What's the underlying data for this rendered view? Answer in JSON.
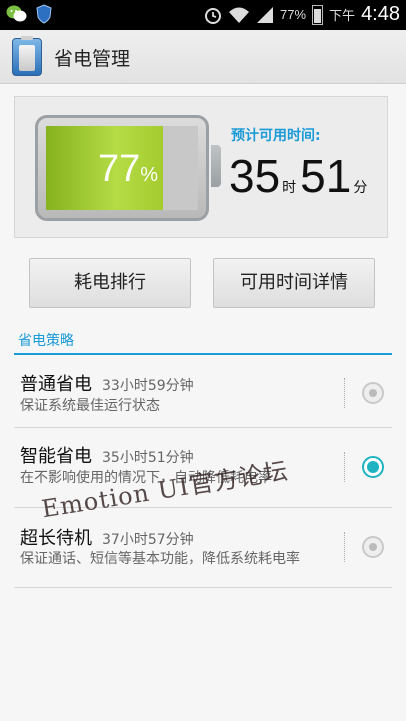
{
  "status_bar": {
    "icons": [
      "wechat-icon",
      "shield-icon",
      "alarm-icon",
      "wifi-icon",
      "signal-icon",
      "battery-icon"
    ],
    "battery_percent": "77%",
    "period": "下午",
    "time": "4:48"
  },
  "action_bar": {
    "title": "省电管理"
  },
  "battery": {
    "level": 0.77,
    "percent_value": "77",
    "percent_sign": "%",
    "fill_color": "#a4cc2f",
    "remain_label": "预计可用时间:",
    "hours": "35",
    "hours_unit": "时",
    "minutes": "51",
    "minutes_unit": "分"
  },
  "buttons": {
    "rank_label": "耗电排行",
    "detail_label": "可用时间详情"
  },
  "section": {
    "title": "省电策略"
  },
  "strategies": [
    {
      "title": "普通省电",
      "time": "33小时59分钟",
      "desc": "保证系统最佳运行状态",
      "selected": false
    },
    {
      "title": "智能省电",
      "time": "35小时51分钟",
      "desc": "在不影响使用的情况下，自动降低耗电率",
      "selected": true
    },
    {
      "title": "超长待机",
      "time": "37小时57分钟",
      "desc": "保证通话、短信等基本功能，降低系统耗电率",
      "selected": false
    }
  ],
  "watermark": "Emotion UI官方论坛",
  "colors": {
    "accent": "#1a9ad6",
    "radio_selected": "#1fb3c2"
  }
}
